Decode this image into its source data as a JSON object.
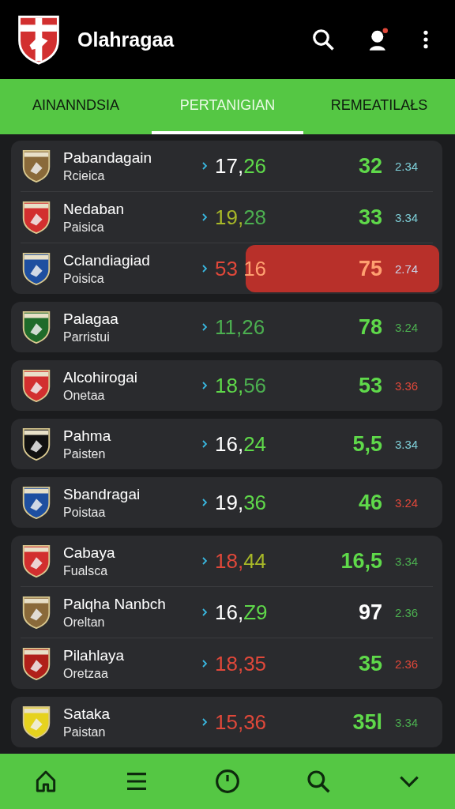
{
  "app_bar": {
    "title": "Olahragaa",
    "notification": true
  },
  "tabs": [
    {
      "label": "AINANNDSIA",
      "selected": false
    },
    {
      "label": "PERTANIGIAN",
      "selected": true
    },
    {
      "label": "REMEATILAŁS",
      "selected": false
    }
  ],
  "cards": [
    {
      "rows": [
        {
          "name": "Pabandagain",
          "sub": "Rcieica",
          "color": "#8a6a3a",
          "odds": [
            {
              "text": "17,",
              "color": "#ffffff"
            },
            {
              "text": "26",
              "color": "#5fd94a"
            }
          ],
          "points": {
            "text": "32",
            "color": "#5fd94a"
          },
          "rate": {
            "text": "2.34",
            "color": "#7ecfd8"
          },
          "highlighted": false
        },
        {
          "name": "Nedaban",
          "sub": "Paisica",
          "color": "#d22f2f",
          "odds": [
            {
              "text": "19,",
              "color": "#a8b828"
            },
            {
              "text": "28",
              "color": "#4caf50"
            }
          ],
          "points": {
            "text": "33",
            "color": "#5fd94a"
          },
          "rate": {
            "text": "3.34",
            "color": "#7ecfd8"
          },
          "highlighted": false
        },
        {
          "name": "Cclandiagiad",
          "sub": "Poisica",
          "color": "#1e4fa0",
          "odds": [
            {
              "text": "53 ",
              "color": "#e0483a"
            },
            {
              "text": "16",
              "color": "#ffa070"
            }
          ],
          "points": {
            "text": "75",
            "color": "#ffa070"
          },
          "rate": {
            "text": "2.74",
            "color": "#c8d4e8"
          },
          "highlighted": true
        }
      ]
    },
    {
      "rows": [
        {
          "name": "Palagaa",
          "sub": "Parristui",
          "color": "#1f6b2a",
          "odds": [
            {
              "text": "11,",
              "color": "#4caf50"
            },
            {
              "text": "26",
              "color": "#4caf50"
            }
          ],
          "points": {
            "text": "78",
            "color": "#5fd94a"
          },
          "rate": {
            "text": "3.24",
            "color": "#4caf50"
          },
          "highlighted": false
        }
      ]
    },
    {
      "rows": [
        {
          "name": "Alcohirogai",
          "sub": "Onetaa",
          "color": "#d22f2f",
          "odds": [
            {
              "text": "18,",
              "color": "#5fd94a"
            },
            {
              "text": "56",
              "color": "#4caf50"
            }
          ],
          "points": {
            "text": "53",
            "color": "#5fd94a"
          },
          "rate": {
            "text": "3.36",
            "color": "#e0483a"
          },
          "highlighted": false
        }
      ]
    },
    {
      "rows": [
        {
          "name": "Pahma",
          "sub": "Paisten",
          "color": "#111111",
          "odds": [
            {
              "text": "16,",
              "color": "#ffffff"
            },
            {
              "text": "24",
              "color": "#5fd94a"
            }
          ],
          "points": {
            "text": "5,5",
            "color": "#5fd94a"
          },
          "rate": {
            "text": "3.34",
            "color": "#7ecfd8"
          },
          "highlighted": false
        }
      ]
    },
    {
      "rows": [
        {
          "name": "Sbandragai",
          "sub": "Poistaa",
          "color": "#1e4fa0",
          "odds": [
            {
              "text": "19,",
              "color": "#ffffff"
            },
            {
              "text": "36",
              "color": "#5fd94a"
            }
          ],
          "points": {
            "text": "46",
            "color": "#5fd94a"
          },
          "rate": {
            "text": "3.24",
            "color": "#e0483a"
          },
          "highlighted": false
        }
      ]
    },
    {
      "rows": [
        {
          "name": "Cabaya",
          "sub": "Fualsca",
          "color": "#d22f2f",
          "odds": [
            {
              "text": "18,",
              "color": "#e0483a"
            },
            {
              "text": "44",
              "color": "#a8b828"
            }
          ],
          "points": {
            "text": "16,5",
            "color": "#5fd94a"
          },
          "rate": {
            "text": "3.34",
            "color": "#4caf50"
          },
          "highlighted": false
        },
        {
          "name": "Palqha Nanbch",
          "sub": "Oreltan",
          "color": "#8a6a3a",
          "odds": [
            {
              "text": "16,",
              "color": "#ffffff"
            },
            {
              "text": "Z9",
              "color": "#5fd94a"
            }
          ],
          "points": {
            "text": "97",
            "color": "#ffffff"
          },
          "rate": {
            "text": "2.36",
            "color": "#4caf50"
          },
          "highlighted": false
        },
        {
          "name": "Pilahlaya",
          "sub": "Oretzaa",
          "color": "#b0201a",
          "odds": [
            {
              "text": "18,",
              "color": "#e0483a"
            },
            {
              "text": "35",
              "color": "#e0483a"
            }
          ],
          "points": {
            "text": "35",
            "color": "#5fd94a"
          },
          "rate": {
            "text": "2.36",
            "color": "#e0483a"
          },
          "highlighted": false
        }
      ]
    },
    {
      "rows": [
        {
          "name": "Sataka",
          "sub": "Paistan",
          "color": "#e6d21e",
          "odds": [
            {
              "text": "15,",
              "color": "#e0483a"
            },
            {
              "text": "36",
              "color": "#e0483a"
            }
          ],
          "points": {
            "text": "35l",
            "color": "#5fd94a"
          },
          "rate": {
            "text": "3.34",
            "color": "#4caf50"
          },
          "highlighted": false
        }
      ]
    }
  ]
}
